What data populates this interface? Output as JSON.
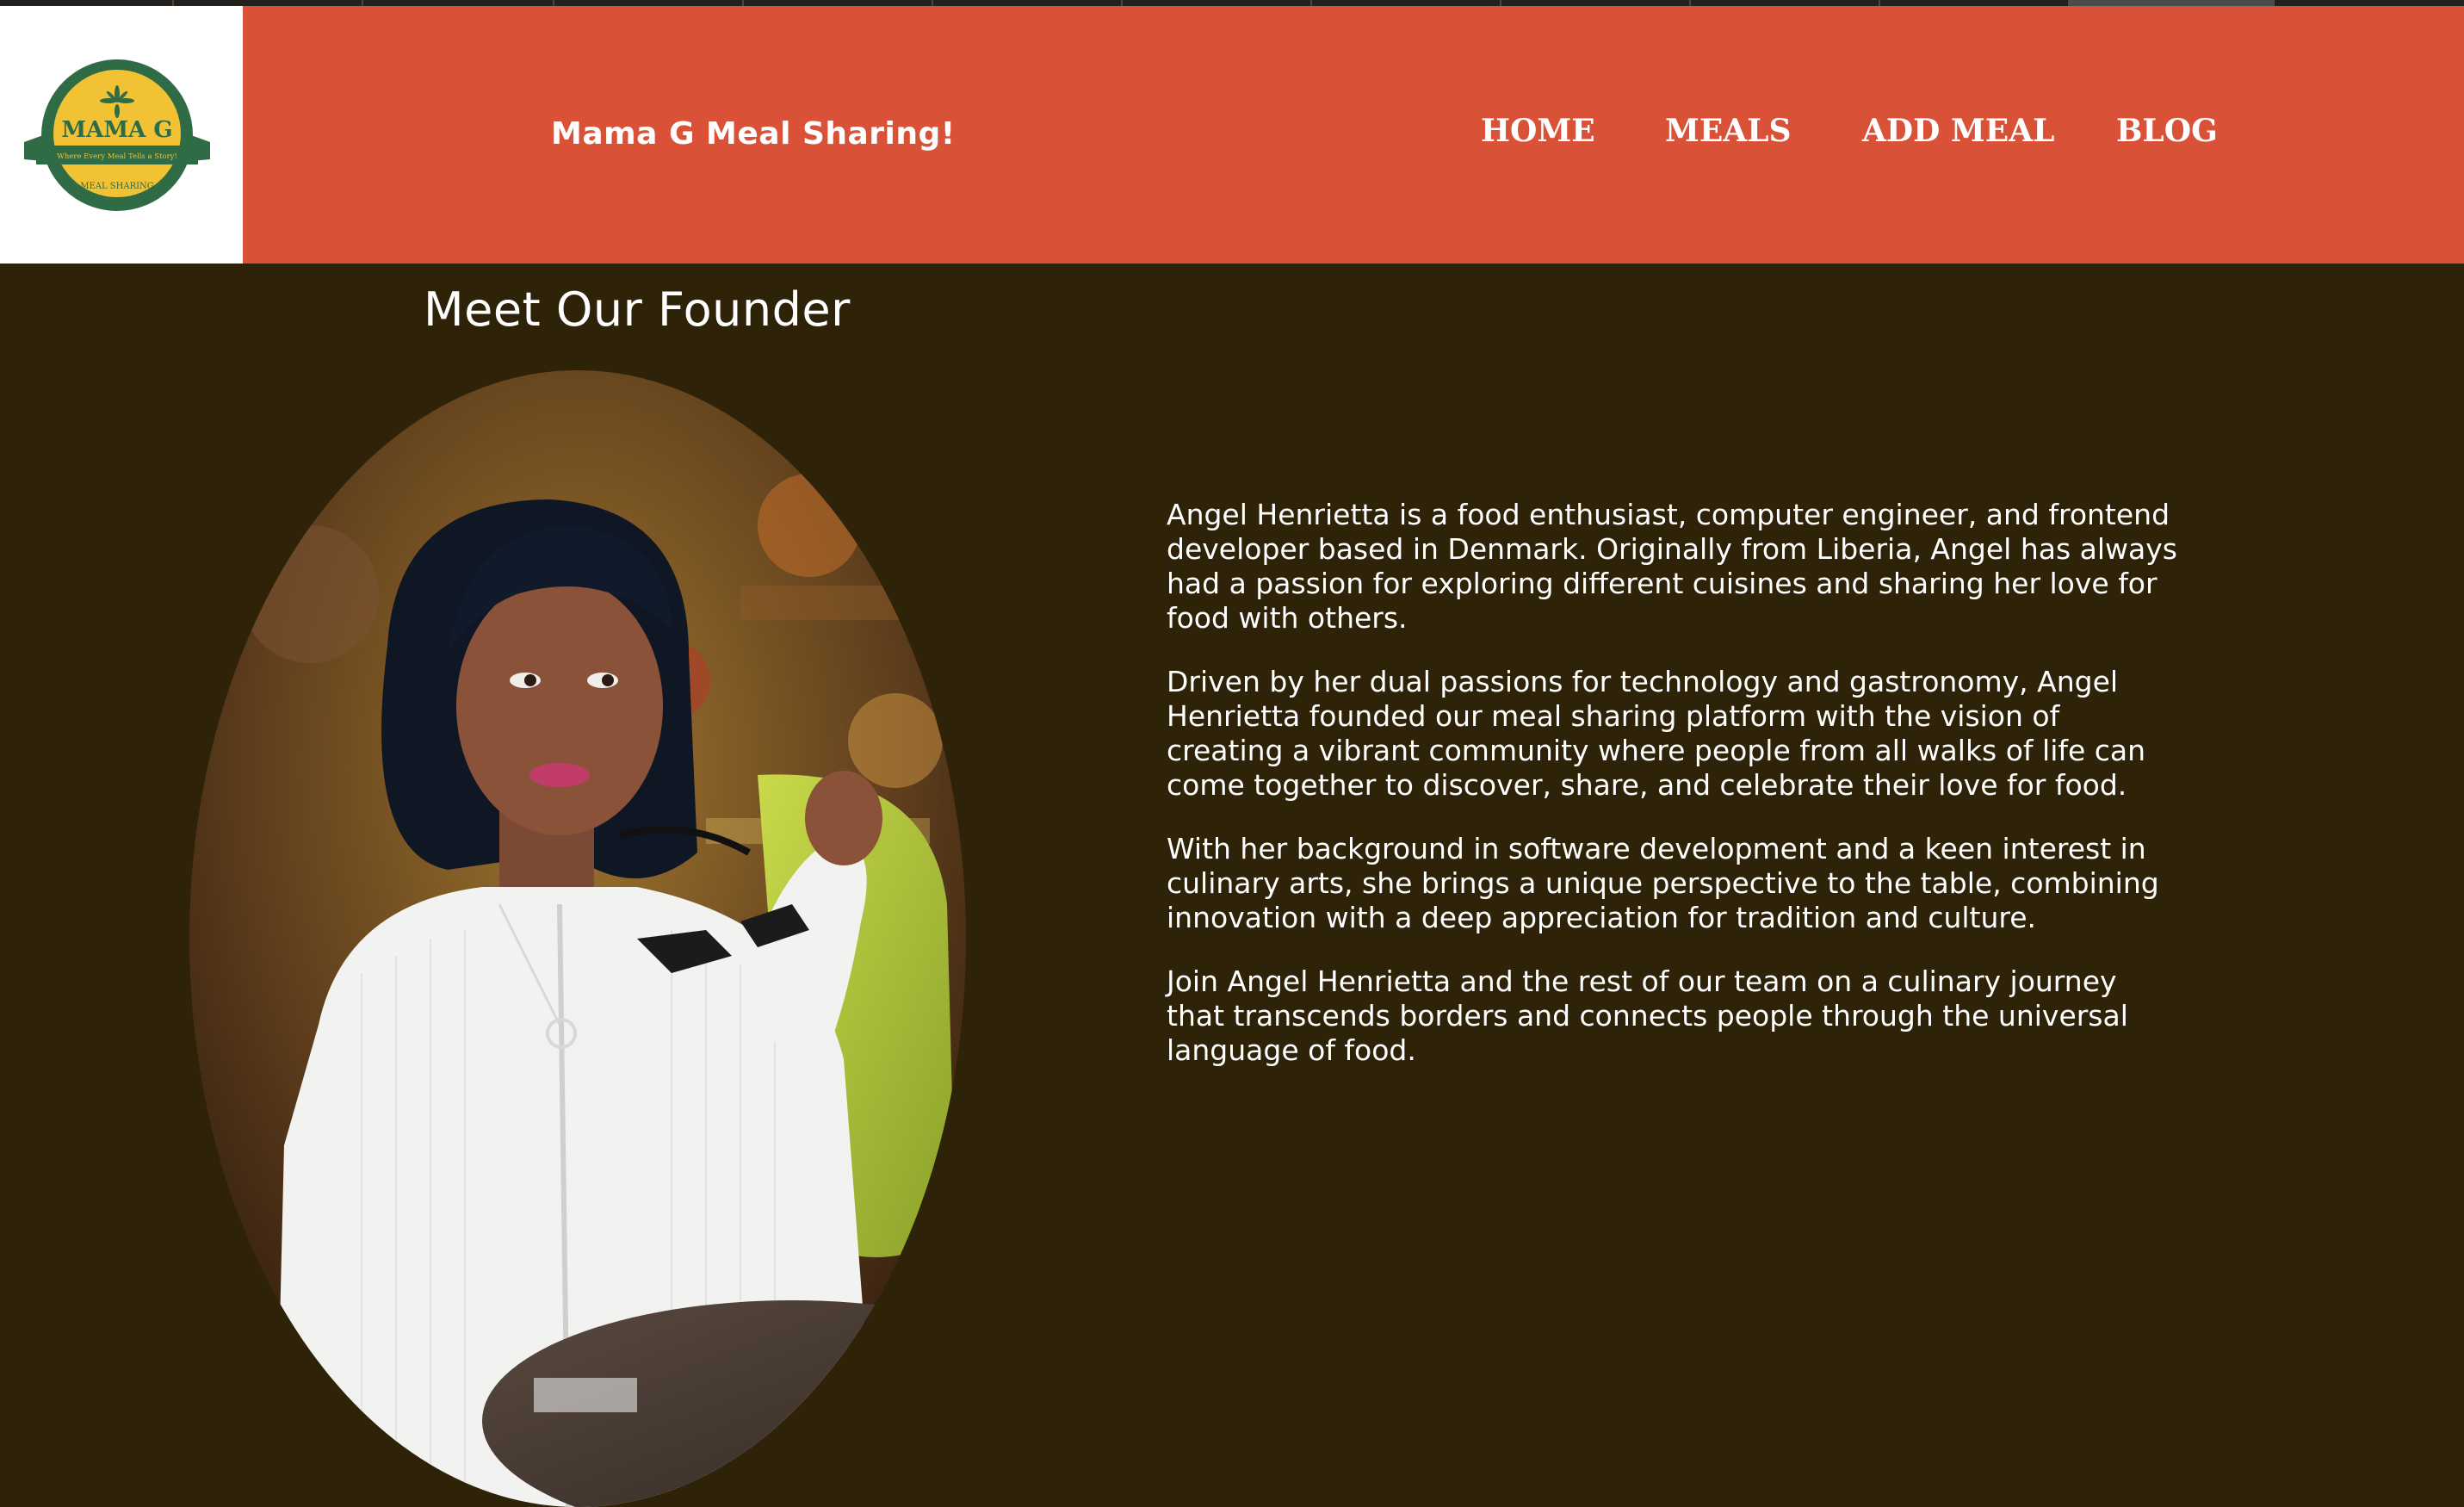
{
  "header": {
    "logo": {
      "name": "MAMA G",
      "tagline": "Where Every Meal Tells a Story!",
      "ribbon_text": "MEAL SHARING"
    },
    "brand_title": "Mama G Meal Sharing!",
    "nav": [
      {
        "label": "HOME"
      },
      {
        "label": "MEALS"
      },
      {
        "label": "ADD MEAL"
      },
      {
        "label": "BLOG"
      }
    ]
  },
  "main": {
    "heading": "Meet Our Founder",
    "bio_paragraphs": [
      "Angel Henrietta is a food enthusiast, computer engineer, and frontend developer based in Denmark. Originally from Liberia, Angel has always had a passion for exploring different cuisines and sharing her love for food with others.",
      "Driven by her dual passions for technology and gastronomy, Angel Henrietta founded our meal sharing platform with the vision of creating a vibrant community where people from all walks of life can come together to discover, share, and celebrate their love for food.",
      "With her background in software development and a keen interest in culinary arts, she brings a unique perspective to the table, combining innovation with a deep appreciation for tradition and culture.",
      "Join Angel Henrietta and the rest of our team on a culinary journey that transcends borders and connects people through the universal language of food."
    ]
  },
  "colors": {
    "header_bg": "#d95237",
    "page_bg": "#2e2208",
    "logo_green": "#2f6b45",
    "logo_yellow": "#f1c233"
  }
}
